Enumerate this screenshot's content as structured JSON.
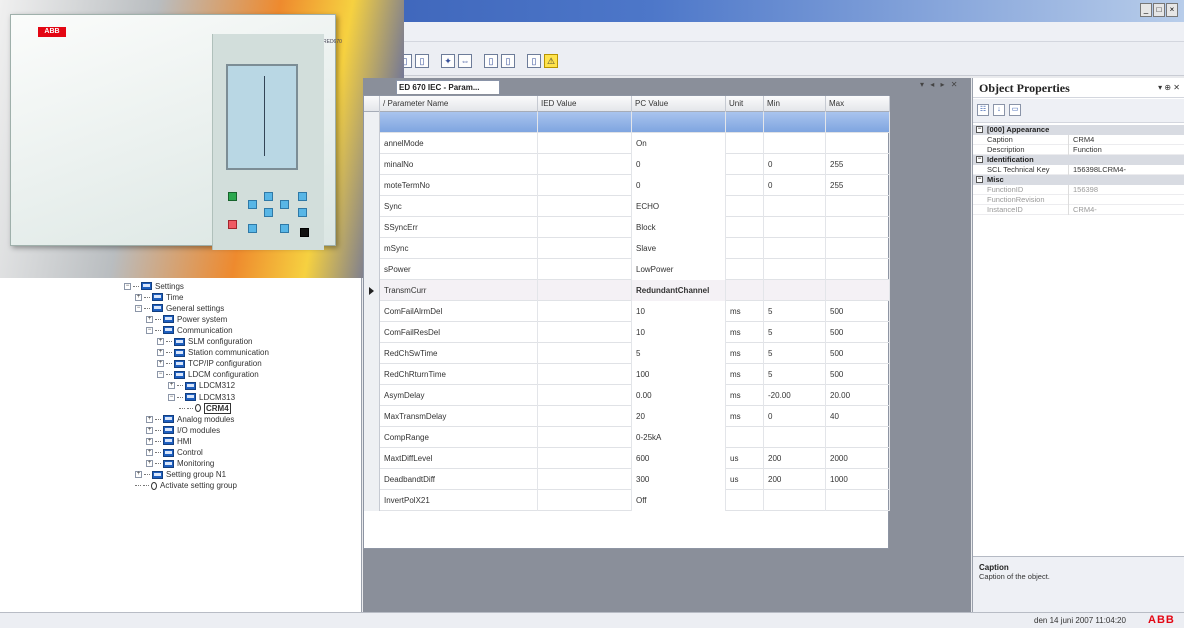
{
  "window": {
    "controls": [
      "_",
      "□",
      "×"
    ]
  },
  "toolbar": {
    "icons": [
      "document-icon",
      "document-icon",
      "settings-icon",
      "arrows-icon",
      "document-icon",
      "document-icon",
      "document-icon",
      "warning-icon"
    ]
  },
  "device": {
    "brand": "ABB",
    "model": "RED670"
  },
  "tree": {
    "items": [
      {
        "label": "Settings",
        "depth": 0,
        "expander": "⊟",
        "icon": "folder"
      },
      {
        "label": "Time",
        "depth": 1,
        "expander": "⊞",
        "icon": "folder"
      },
      {
        "label": "General settings",
        "depth": 1,
        "expander": "⊟",
        "icon": "folder"
      },
      {
        "label": "Power system",
        "depth": 2,
        "expander": "⊞",
        "icon": "folder"
      },
      {
        "label": "Communication",
        "depth": 2,
        "expander": "⊟",
        "icon": "folder"
      },
      {
        "label": "SLM configuration",
        "depth": 3,
        "expander": "⊞",
        "icon": "folder"
      },
      {
        "label": "Station communication",
        "depth": 3,
        "expander": "⊞",
        "icon": "folder"
      },
      {
        "label": "TCP/IP configuration",
        "depth": 3,
        "expander": "⊞",
        "icon": "folder"
      },
      {
        "label": "LDCM configuration",
        "depth": 3,
        "expander": "⊟",
        "icon": "folder"
      },
      {
        "label": "LDCM312",
        "depth": 4,
        "expander": "⊞",
        "icon": "folder"
      },
      {
        "label": "LDCM313",
        "depth": 4,
        "expander": "⊟",
        "icon": "folder"
      },
      {
        "label": "CRM4",
        "depth": 5,
        "expander": "",
        "icon": "node",
        "selected": true
      },
      {
        "label": "Analog modules",
        "depth": 2,
        "expander": "⊞",
        "icon": "folder"
      },
      {
        "label": "I/O modules",
        "depth": 2,
        "expander": "⊞",
        "icon": "folder"
      },
      {
        "label": "HMI",
        "depth": 2,
        "expander": "⊞",
        "icon": "folder"
      },
      {
        "label": "Control",
        "depth": 2,
        "expander": "⊞",
        "icon": "folder"
      },
      {
        "label": "Monitoring",
        "depth": 2,
        "expander": "⊞",
        "icon": "folder"
      },
      {
        "label": "Setting group N1",
        "depth": 1,
        "expander": "⊞",
        "icon": "folder"
      },
      {
        "label": "Activate setting group",
        "depth": 1,
        "expander": "",
        "icon": "node"
      }
    ]
  },
  "document": {
    "tab_label": "ED 670 IEC - Param...",
    "controls": "▾ ◂ ▸ ✕"
  },
  "grid": {
    "columns": [
      "/ Parameter Name",
      "IED Value",
      "PC Value",
      "Unit",
      "Min",
      "Max"
    ],
    "rows": [
      {
        "name": "",
        "ied": "",
        "pc": "",
        "unit": "",
        "min": "",
        "max": "",
        "state": "selected"
      },
      {
        "name": "annelMode",
        "ied": "",
        "pc": "On",
        "unit": "",
        "min": "",
        "max": ""
      },
      {
        "name": "minalNo",
        "ied": "",
        "pc": "0",
        "unit": "",
        "min": "0",
        "max": "255"
      },
      {
        "name": "moteTermNo",
        "ied": "",
        "pc": "0",
        "unit": "",
        "min": "0",
        "max": "255"
      },
      {
        "name": "Sync",
        "ied": "",
        "pc": "ECHO",
        "unit": "",
        "min": "",
        "max": ""
      },
      {
        "name": "SSyncErr",
        "ied": "",
        "pc": "Block",
        "unit": "",
        "min": "",
        "max": ""
      },
      {
        "name": "mSync",
        "ied": "",
        "pc": "Slave",
        "unit": "",
        "min": "",
        "max": ""
      },
      {
        "name": "sPower",
        "ied": "",
        "pc": "LowPower",
        "unit": "",
        "min": "",
        "max": ""
      },
      {
        "name": "TransmCurr",
        "ied": "",
        "pc": "RedundantChannel",
        "unit": "",
        "min": "",
        "max": "",
        "state": "current"
      },
      {
        "name": "ComFailAlrmDel",
        "ied": "",
        "pc": "10",
        "unit": "ms",
        "min": "5",
        "max": "500"
      },
      {
        "name": "ComFailResDel",
        "ied": "",
        "pc": "10",
        "unit": "ms",
        "min": "5",
        "max": "500"
      },
      {
        "name": "RedChSwTime",
        "ied": "",
        "pc": "5",
        "unit": "ms",
        "min": "5",
        "max": "500"
      },
      {
        "name": "RedChRturnTime",
        "ied": "",
        "pc": "100",
        "unit": "ms",
        "min": "5",
        "max": "500"
      },
      {
        "name": "AsymDelay",
        "ied": "",
        "pc": "0.00",
        "unit": "ms",
        "min": "-20.00",
        "max": "20.00"
      },
      {
        "name": "MaxTransmDelay",
        "ied": "",
        "pc": "20",
        "unit": "ms",
        "min": "0",
        "max": "40"
      },
      {
        "name": "CompRange",
        "ied": "",
        "pc": "0-25kA",
        "unit": "",
        "min": "",
        "max": ""
      },
      {
        "name": "MaxtDiffLevel",
        "ied": "",
        "pc": "600",
        "unit": "us",
        "min": "200",
        "max": "2000"
      },
      {
        "name": "DeadbandtDiff",
        "ied": "",
        "pc": "300",
        "unit": "us",
        "min": "200",
        "max": "1000"
      },
      {
        "name": "InvertPolX21",
        "ied": "",
        "pc": "Off",
        "unit": "",
        "min": "",
        "max": ""
      }
    ]
  },
  "properties": {
    "title": "Object Properties",
    "controls": "▾ ⊕ ✕",
    "categories": [
      {
        "name": "[000] Appearance",
        "rows": [
          {
            "key": "Caption",
            "value": "CRM4",
            "readonly": false
          },
          {
            "key": "Description",
            "value": "Function",
            "readonly": false
          }
        ]
      },
      {
        "name": "Identification",
        "rows": [
          {
            "key": "SCL Technical Key",
            "value": "156398LCRM4-",
            "readonly": false
          }
        ]
      },
      {
        "name": "Misc",
        "rows": [
          {
            "key": "FunctionID",
            "value": "156398",
            "readonly": true
          },
          {
            "key": "FunctionRevision",
            "value": "",
            "readonly": true
          },
          {
            "key": "InstanceID",
            "value": "CRM4-",
            "readonly": true
          }
        ]
      }
    ],
    "description_title": "Caption",
    "description_text": "Caption of the object."
  },
  "status": {
    "datetime": "den 14 juni 2007 11:04:20",
    "logo": "ABB"
  },
  "colors": {
    "brand_red": "#e30613",
    "selection_blue": "#7fa5e0",
    "title_blue": "#2b4fa8"
  }
}
